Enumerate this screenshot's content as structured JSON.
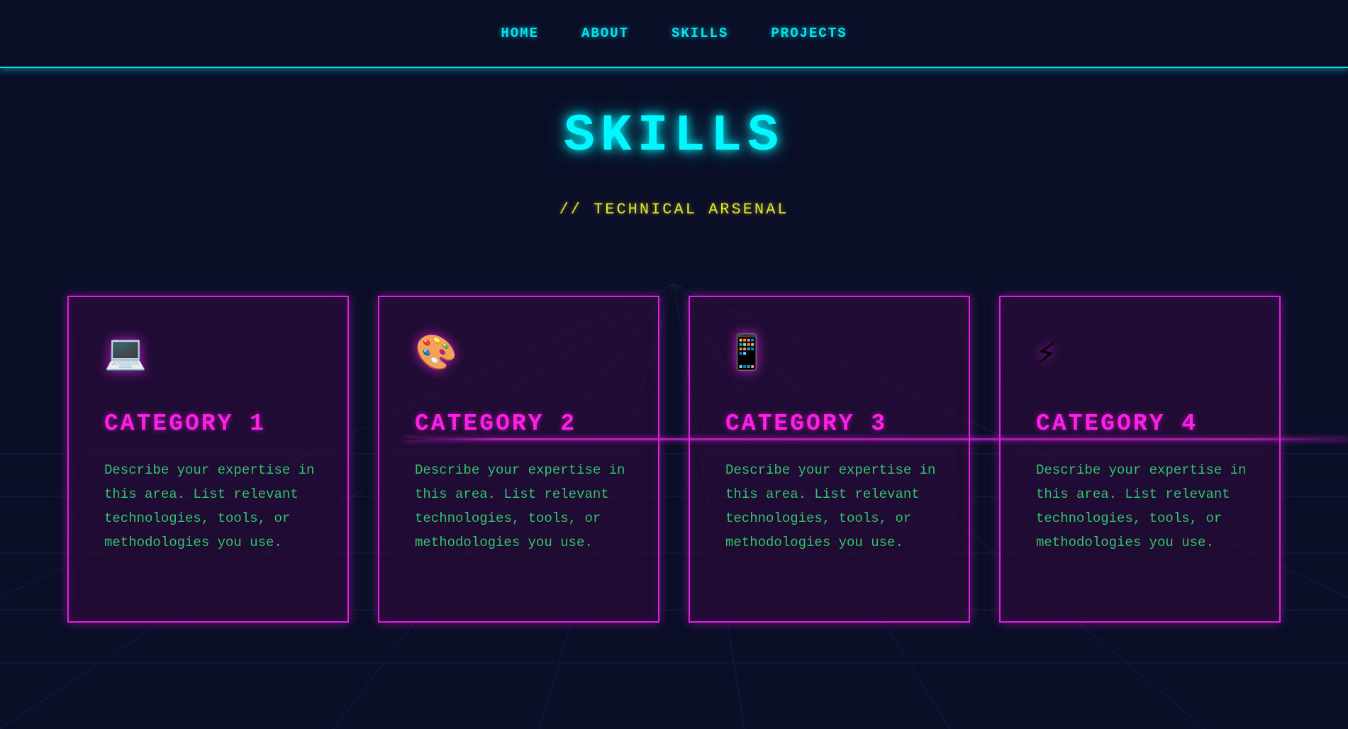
{
  "nav": {
    "items": [
      {
        "label": "HOME"
      },
      {
        "label": "ABOUT"
      },
      {
        "label": "SKILLS"
      },
      {
        "label": "PROJECTS"
      }
    ]
  },
  "header": {
    "title": "SKILLS",
    "subtitle": "// TECHNICAL ARSENAL"
  },
  "cards": [
    {
      "icon": "💻",
      "icon_name": "laptop-icon",
      "title": "CATEGORY 1",
      "description": "Describe your expertise in this area. List relevant technologies, tools, or methodologies you use."
    },
    {
      "icon": "🎨",
      "icon_name": "palette-icon",
      "title": "CATEGORY 2",
      "description": "Describe your expertise in this area. List relevant technologies, tools, or methodologies you use."
    },
    {
      "icon": "📱",
      "icon_name": "mobile-phone-icon",
      "title": "CATEGORY 3",
      "description": "Describe your expertise in this area. List relevant technologies, tools, or methodologies you use."
    },
    {
      "icon": "⚡",
      "icon_name": "lightning-icon",
      "title": "CATEGORY 4",
      "description": "Describe your expertise in this area. List relevant technologies, tools, or methodologies you use."
    }
  ],
  "colors": {
    "background": "#0a0e27",
    "cyan_accent": "#00e5ee",
    "magenta_accent": "#e020e0",
    "yellow_accent": "#e8e42a",
    "green_text": "#2ec56b"
  }
}
